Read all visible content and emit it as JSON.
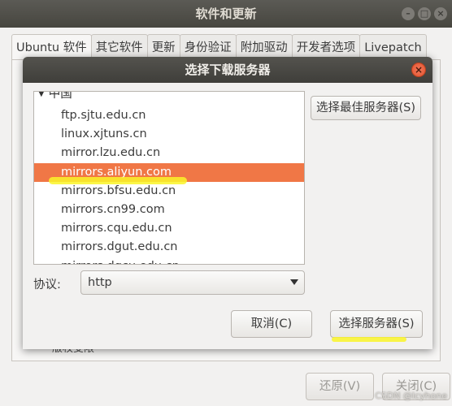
{
  "window": {
    "title": "软件和更新",
    "tabs": [
      "Ubuntu 软件",
      "其它软件",
      "更新",
      "身份验证",
      "附加驱动",
      "开发者选项",
      "Livepatch"
    ],
    "partial_label": "版权受限",
    "revert_label": "还原(V)",
    "close_label": "关闭(C)"
  },
  "dialog": {
    "title": "选择下载服务器",
    "country": "中国",
    "servers": [
      "ftp.sjtu.edu.cn",
      "linux.xjtuns.cn",
      "mirror.lzu.edu.cn",
      "mirrors.aliyun.com",
      "mirrors.bfsu.edu.cn",
      "mirrors.cn99.com",
      "mirrors.cqu.edu.cn",
      "mirrors.dgut.edu.cn",
      "mirrors.dqcu.edu.cn"
    ],
    "selected_server": "mirrors.aliyun.com",
    "best_server_label": "选择最佳服务器(S)",
    "protocol_label": "协议:",
    "protocol_value": "http",
    "cancel_label": "取消(C)",
    "choose_label": "选择服务器(S)"
  },
  "watermark": "CSDN @lcyhone",
  "colors": {
    "selection": "#f07746",
    "highlight_marker": "#faf528",
    "titlebar": "#3f3e3a"
  },
  "icons": {
    "close": "close-icon",
    "expand": "triangle-down-icon",
    "dropdown": "chevron-down-icon"
  }
}
